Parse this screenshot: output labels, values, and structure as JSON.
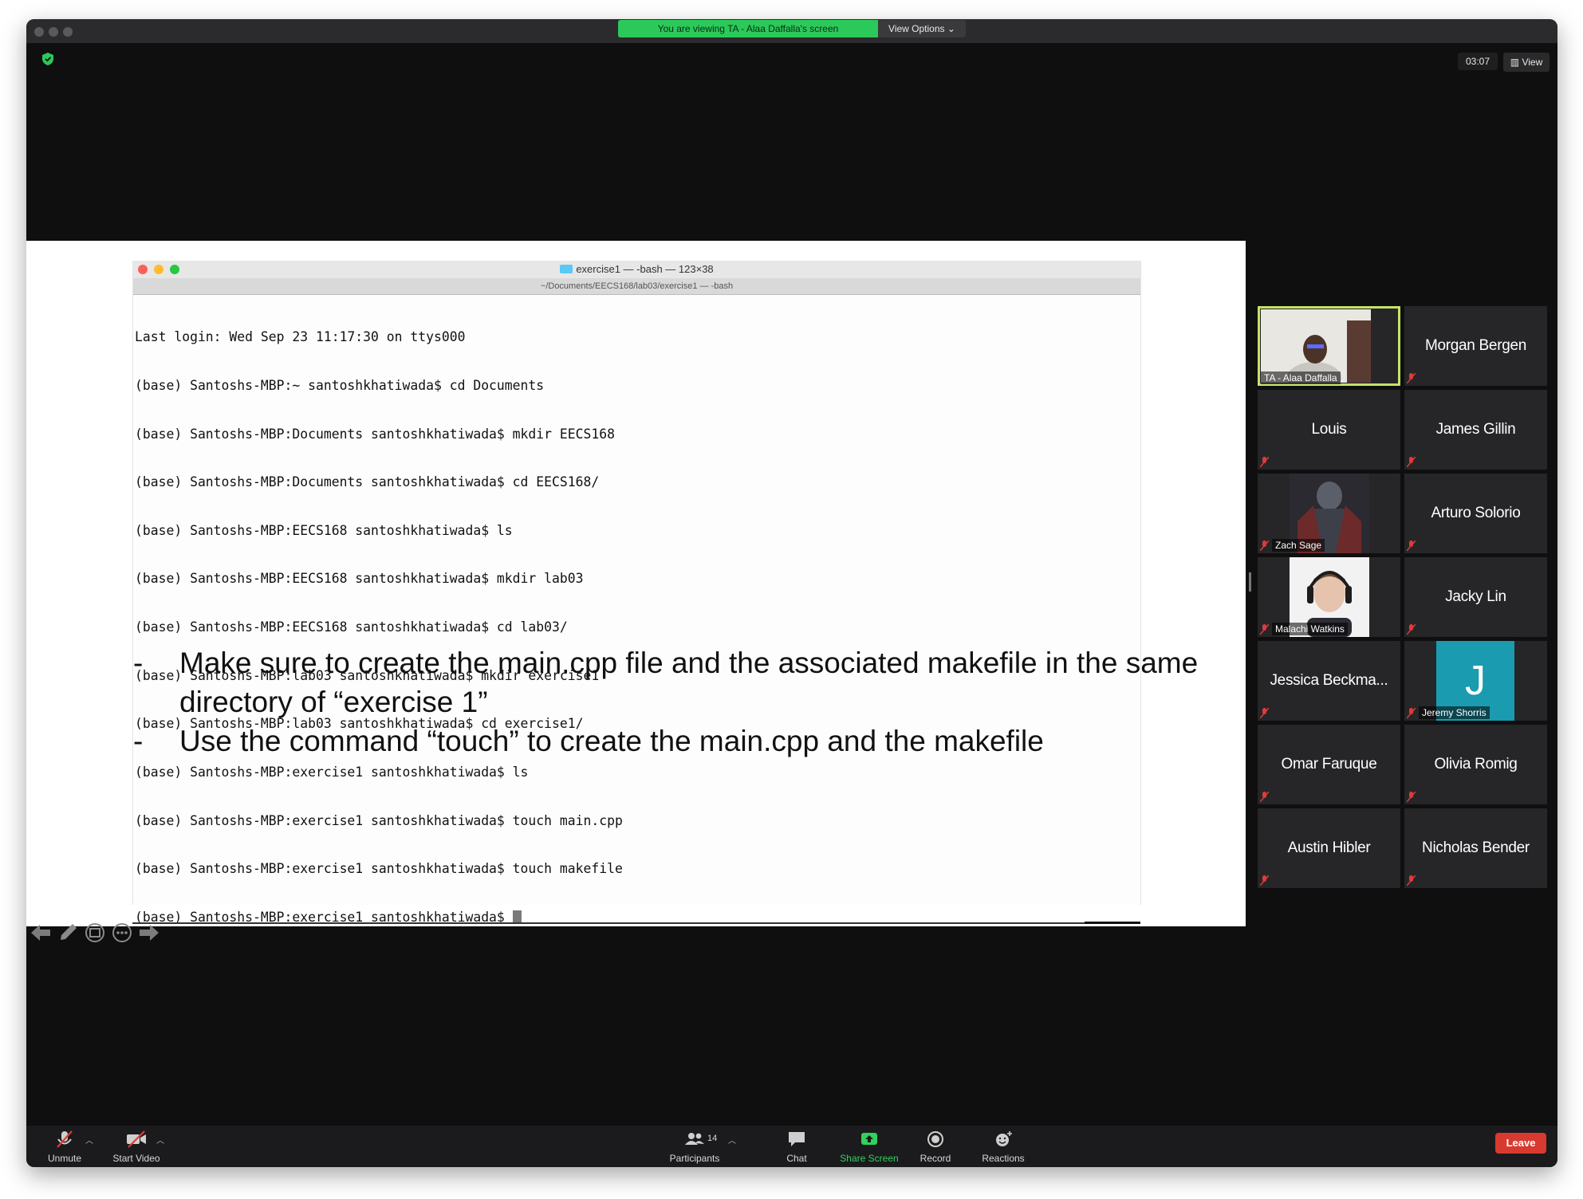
{
  "zoom": {
    "banner_text": "You are viewing TA - Alaa Daffalla's screen",
    "view_options_label": "View Options",
    "timer": "03:07",
    "view_label": "View"
  },
  "terminal": {
    "title": "exercise1 — -bash — 123×38",
    "subtitle": "~/Documents/EECS168/lab03/exercise1 — -bash",
    "lines": [
      "Last login: Wed Sep 23 11:17:30 on ttys000",
      "(base) Santoshs-MBP:~ santoshkhatiwada$ cd Documents",
      "(base) Santoshs-MBP:Documents santoshkhatiwada$ mkdir EECS168",
      "(base) Santoshs-MBP:Documents santoshkhatiwada$ cd EECS168/",
      "(base) Santoshs-MBP:EECS168 santoshkhatiwada$ ls",
      "(base) Santoshs-MBP:EECS168 santoshkhatiwada$ mkdir lab03",
      "(base) Santoshs-MBP:EECS168 santoshkhatiwada$ cd lab03/",
      "(base) Santoshs-MBP:lab03 santoshkhatiwada$ mkdir exercise1",
      "(base) Santoshs-MBP:lab03 santoshkhatiwada$ cd exercise1/",
      "(base) Santoshs-MBP:exercise1 santoshkhatiwada$ ls",
      "(base) Santoshs-MBP:exercise1 santoshkhatiwada$ touch main.cpp",
      "(base) Santoshs-MBP:exercise1 santoshkhatiwada$ touch makefile",
      "(base) Santoshs-MBP:exercise1 santoshkhatiwada$ "
    ]
  },
  "slide": {
    "bullets": [
      "Make sure to create the main.cpp file and the associated makefile in the same directory of “exercise 1”",
      "Use the command “touch” to create the main.cpp and the makefile"
    ],
    "dash": "-"
  },
  "participants": [
    {
      "name": "TA - Alaa Daffalla",
      "video": true,
      "active": true
    },
    {
      "name": "Morgan Bergen",
      "video": false
    },
    {
      "name": "Louis",
      "video": false
    },
    {
      "name": "James Gillin",
      "video": false
    },
    {
      "name": "Zach Sage",
      "video": true
    },
    {
      "name": "Arturo Solorio",
      "video": false
    },
    {
      "name": "Malachi Watkins",
      "video": true
    },
    {
      "name": "Jacky Lin",
      "video": false
    },
    {
      "name": "Jessica Beckma...",
      "video": false
    },
    {
      "name": "Jeremy Shorris",
      "video": false,
      "avatar_letter": "J",
      "avatar_color": "#1a9bb0"
    },
    {
      "name": "Omar Faruque",
      "video": false
    },
    {
      "name": "Olivia Romig",
      "video": false
    },
    {
      "name": "Austin Hibler",
      "video": false
    },
    {
      "name": "Nicholas Bender",
      "video": false
    }
  ],
  "toolbar": {
    "unmute": "Unmute",
    "start_video": "Start Video",
    "participants": "Participants",
    "participants_count": "14",
    "chat": "Chat",
    "share_screen": "Share Screen",
    "record": "Record",
    "reactions": "Reactions",
    "leave": "Leave"
  },
  "colors": {
    "banner_green": "#2bc95a",
    "active_speaker": "#c6e26a",
    "leave_red": "#d83a30",
    "share_green": "#30d25b"
  }
}
